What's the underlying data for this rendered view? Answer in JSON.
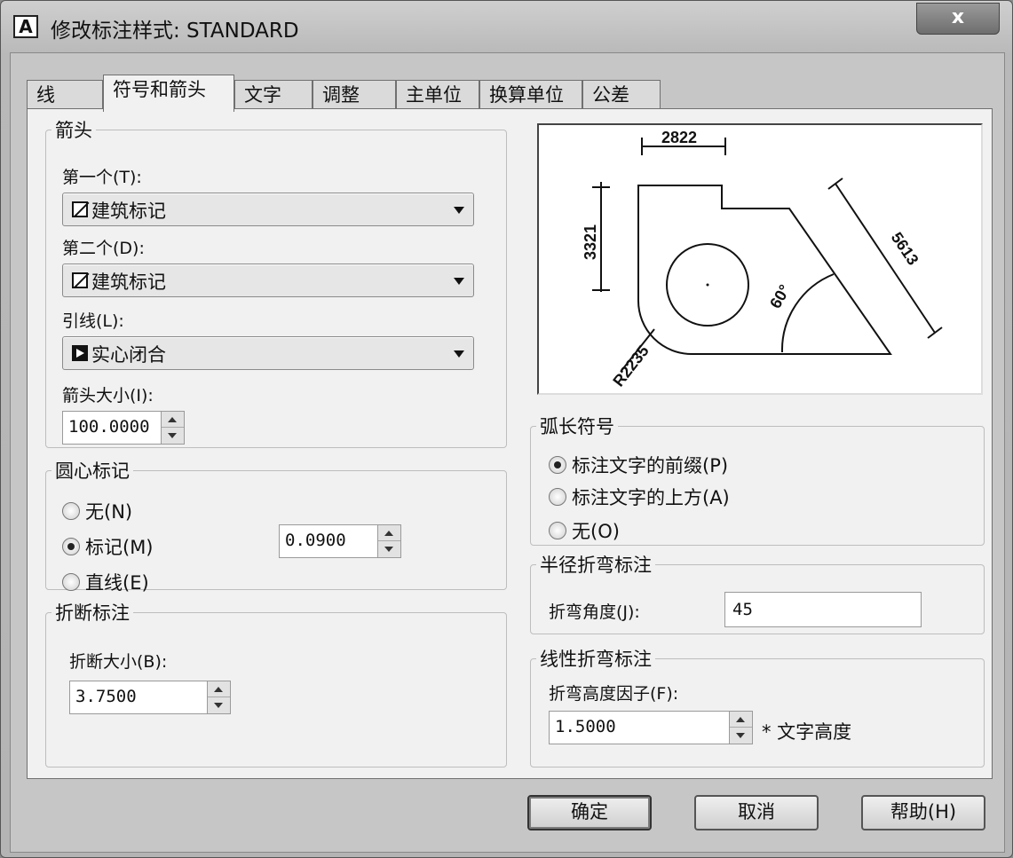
{
  "window": {
    "title": "修改标注样式: STANDARD",
    "app_icon_letter": "A",
    "close_glyph": "x"
  },
  "tabs": [
    {
      "label": "线"
    },
    {
      "label": "符号和箭头",
      "active": true
    },
    {
      "label": "文字"
    },
    {
      "label": "调整"
    },
    {
      "label": "主单位"
    },
    {
      "label": "换算单位"
    },
    {
      "label": "公差"
    }
  ],
  "arrowheads": {
    "legend": "箭头",
    "first_label": "第一个(T):",
    "first_value": "建筑标记",
    "second_label": "第二个(D):",
    "second_value": "建筑标记",
    "leader_label": "引线(L):",
    "leader_value": "实心闭合",
    "size_label": "箭头大小(I):",
    "size_value": "100.0000"
  },
  "center_marks": {
    "legend": "圆心标记",
    "options": [
      {
        "label": "无(N)",
        "selected": false
      },
      {
        "label": "标记(M)",
        "selected": true
      },
      {
        "label": "直线(E)",
        "selected": false
      }
    ],
    "size_value": "0.0900"
  },
  "dimension_break": {
    "legend": "折断标注",
    "size_label": "折断大小(B):",
    "size_value": "3.7500"
  },
  "preview": {
    "dim_top": "2822",
    "dim_left": "3321",
    "dim_diag": "5613",
    "dim_angle": "60°",
    "dim_radius": "R2235"
  },
  "arc_length_symbol": {
    "legend": "弧长符号",
    "options": [
      {
        "label": "标注文字的前缀(P)",
        "selected": true
      },
      {
        "label": "标注文字的上方(A)",
        "selected": false
      },
      {
        "label": "无(O)",
        "selected": false
      }
    ]
  },
  "radius_jog": {
    "legend": "半径折弯标注",
    "angle_label": "折弯角度(J):",
    "angle_value": "45"
  },
  "linear_jog": {
    "legend": "线性折弯标注",
    "height_label": "折弯高度因子(F):",
    "height_value": "1.5000",
    "suffix": "* 文字高度"
  },
  "buttons": {
    "ok": "确定",
    "cancel": "取消",
    "help": "帮助(H)"
  }
}
